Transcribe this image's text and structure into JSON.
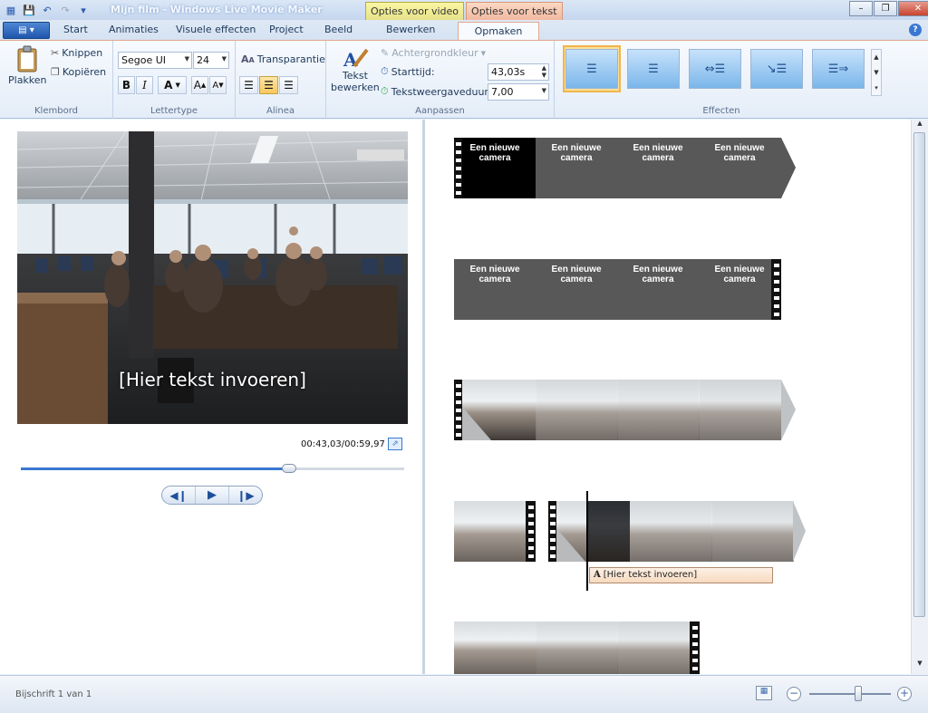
{
  "window": {
    "title": "Mijn film - Windows Live Movie Maker",
    "context_tabs": [
      "Opties voor video",
      "Opties voor tekst"
    ]
  },
  "ribbon_tabs": {
    "start": "Start",
    "animaties": "Animaties",
    "visuele_effecten": "Visuele effecten",
    "project": "Project",
    "beeld": "Beeld",
    "bewerken": "Bewerken",
    "opmaken": "Opmaken"
  },
  "klembord": {
    "group": "Klembord",
    "plakken": "Plakken",
    "knippen": "Knippen",
    "kopieren": "Kopiëren"
  },
  "lettertype": {
    "group": "Lettertype",
    "font": "Segoe UI",
    "size": "24",
    "transparantie": "Transparantie",
    "bold": "B",
    "italic": "I",
    "color": "A",
    "grow": "A",
    "shrink": "A"
  },
  "alinea": {
    "group": "Alinea"
  },
  "aanpassen": {
    "group": "Aanpassen",
    "tekst_bewerken": "Tekst\nbewerken",
    "tekst_bewerken_1": "Tekst",
    "tekst_bewerken_2": "bewerken",
    "achtergrondkleur": "Achtergrondkleur",
    "starttijd_label": "Starttijd:",
    "starttijd_value": "43,03s",
    "duur_label": "Tekstweergaveduur:",
    "duur_value": "7,00"
  },
  "effecten": {
    "group": "Effecten"
  },
  "preview": {
    "overlay_text": "[Hier tekst invoeren]",
    "time": "00:43,03/00:59,97",
    "seek_position": 0.7
  },
  "storyboard": {
    "title_card_text": "Een nieuwe camera",
    "title_line1": "Een nieuwe",
    "title_line2": "camera",
    "caption_text": "[Hier tekst invoeren]",
    "caption_icon": "A"
  },
  "status": {
    "text": "Bijschrift 1 van 1"
  },
  "colors": {
    "accent": "#3a78d2",
    "context_video": "#f1ec9a",
    "context_text": "#f6c6ad",
    "title_card": "#585858"
  }
}
